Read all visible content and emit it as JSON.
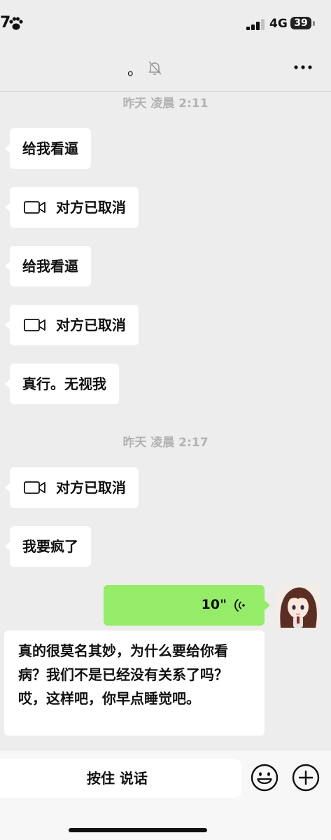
{
  "status_bar": {
    "time_fragment": "7",
    "network": "4G",
    "battery": "39"
  },
  "nav": {
    "title": "。"
  },
  "messages": {
    "timestamp_1": "昨天 凌晨 2:11",
    "msg_1": "给我看逼",
    "call_1": "对方已取消",
    "msg_2": "给我看逼",
    "call_2": "对方已取消",
    "msg_3": "真行。无视我",
    "timestamp_2": "昨天 凌晨 2:17",
    "call_3": "对方已取消",
    "msg_4": "我要疯了",
    "voice_duration": "10\"",
    "msg_5": "真的很莫名其妙，为什么要给你看病？我们不是已经没有关系了吗？哎，这样吧，你早点睡觉吧。"
  },
  "input_bar": {
    "hold_to_talk": "按住 说话"
  },
  "icons": {
    "paw": "paw-icon",
    "mute": "bell-muted-icon",
    "more": "more-icon",
    "video_call": "video-camera-icon",
    "voice": "voice-wave-icon",
    "emoji": "smiley-icon",
    "plus": "plus-circle-icon"
  },
  "colors": {
    "background": "#ededed",
    "bubble_incoming": "#ffffff",
    "bubble_outgoing": "#95ec69",
    "timestamp": "#b2b2b2"
  }
}
